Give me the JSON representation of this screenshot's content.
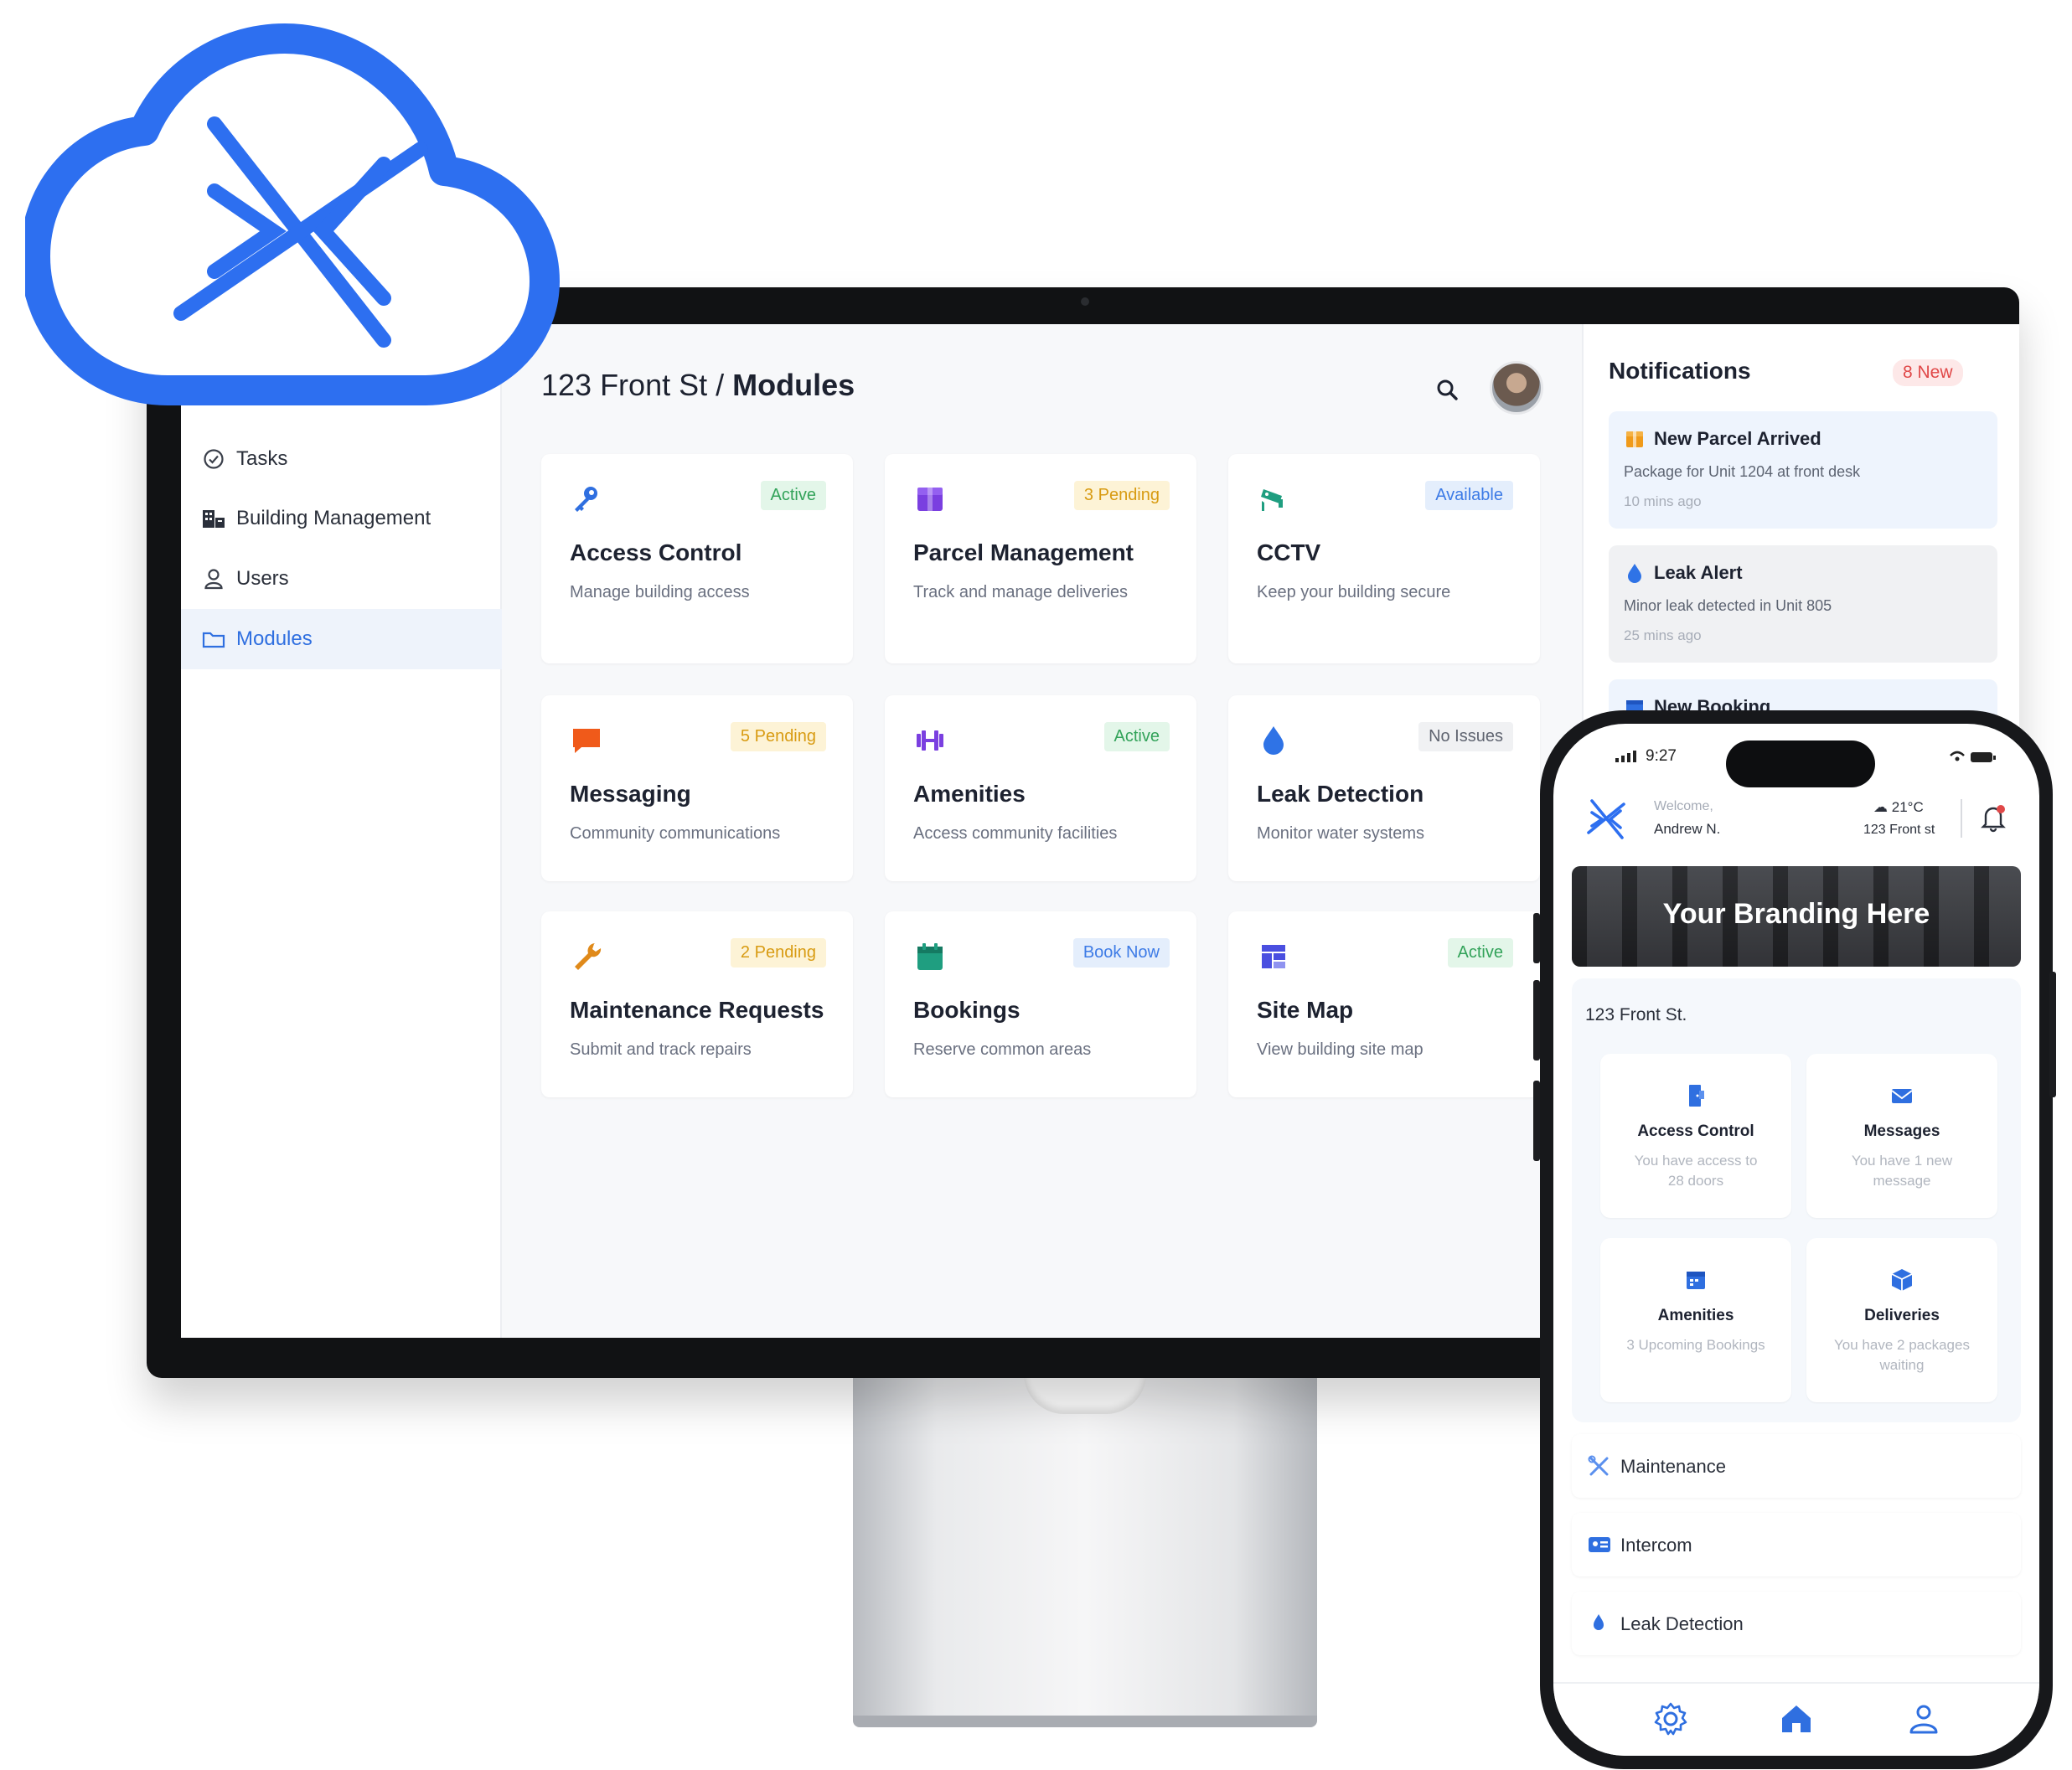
{
  "app": {
    "breadcrumb_location": "123 Front St",
    "breadcrumb_sep": " / ",
    "breadcrumb_page": "Modules"
  },
  "sidebar": {
    "items": [
      {
        "label": "Tasks",
        "icon": "check-circle-icon"
      },
      {
        "label": "Building Management",
        "icon": "building-icon"
      },
      {
        "label": "Users",
        "icon": "user-icon"
      },
      {
        "label": "Modules",
        "icon": "folder-icon",
        "active": true
      }
    ]
  },
  "modules": [
    {
      "title": "Access Control",
      "subtitle": "Manage building access",
      "badge": "Active",
      "badge_style": "green",
      "icon": "key-icon"
    },
    {
      "title": "Parcel Management",
      "subtitle": "Track and manage deliveries",
      "badge": "3 Pending",
      "badge_style": "yellow",
      "icon": "box-icon"
    },
    {
      "title": "CCTV",
      "subtitle": "Keep your building secure",
      "badge": "Available",
      "badge_style": "blue",
      "icon": "camera-icon"
    },
    {
      "title": "Messaging",
      "subtitle": "Community communications",
      "badge": "5 Pending",
      "badge_style": "yellow",
      "icon": "chat-icon"
    },
    {
      "title": "Amenities",
      "subtitle": "Access community facilities",
      "badge": "Active",
      "badge_style": "green",
      "icon": "dumbbell-icon"
    },
    {
      "title": "Leak Detection",
      "subtitle": "Monitor water systems",
      "badge": "No Issues",
      "badge_style": "gray",
      "icon": "droplet-icon"
    },
    {
      "title": "Maintenance Requests",
      "subtitle": "Submit and track repairs",
      "badge": "2 Pending",
      "badge_style": "yellow",
      "icon": "wrench-icon"
    },
    {
      "title": "Bookings",
      "subtitle": "Reserve common areas",
      "badge": "Book Now",
      "badge_style": "blue",
      "icon": "calendar-icon"
    },
    {
      "title": "Site Map",
      "subtitle": "View building site map",
      "badge": "Active",
      "badge_style": "green",
      "icon": "map-icon"
    }
  ],
  "notifications": {
    "title": "Notifications",
    "count": "8 New",
    "items": [
      {
        "title": "New Parcel Arrived",
        "body": "Package for Unit 1204 at front desk",
        "time": "10 mins ago",
        "icon": "box-icon"
      },
      {
        "title": "Leak Alert",
        "body": "Minor leak detected in Unit 805",
        "time": "25 mins ago",
        "icon": "droplet-icon"
      },
      {
        "title": "New Booking",
        "icon": "calendar-icon"
      }
    ]
  },
  "phone": {
    "time": "9:27",
    "welcome": "Welcome,",
    "user": "Andrew N.",
    "temperature": "21°C",
    "address": "123 Front st",
    "banner": "Your Branding Here",
    "section_title": "123 Front St.",
    "tiles": [
      {
        "title": "Access Control",
        "subtitle": "You have access to 28 doors",
        "icon": "door-icon"
      },
      {
        "title": "Messages",
        "subtitle": "You have 1 new message",
        "icon": "envelope-icon"
      },
      {
        "title": "Amenities",
        "subtitle": "3 Upcoming Bookings",
        "icon": "calendar-icon"
      },
      {
        "title": "Deliveries",
        "subtitle": "You have 2 packages waiting",
        "icon": "package-icon"
      }
    ],
    "rows": [
      {
        "label": "Maintenance",
        "icon": "tools-icon"
      },
      {
        "label": "Intercom",
        "icon": "id-card-icon"
      },
      {
        "label": "Leak Detection",
        "icon": "droplet-icon"
      }
    ],
    "tabs": [
      "settings-icon",
      "home-icon",
      "profile-icon"
    ]
  },
  "colors": {
    "brand_blue": "#2f6fe0",
    "cloud_blue": "#2d6ff0",
    "alert_red": "#e04848"
  }
}
